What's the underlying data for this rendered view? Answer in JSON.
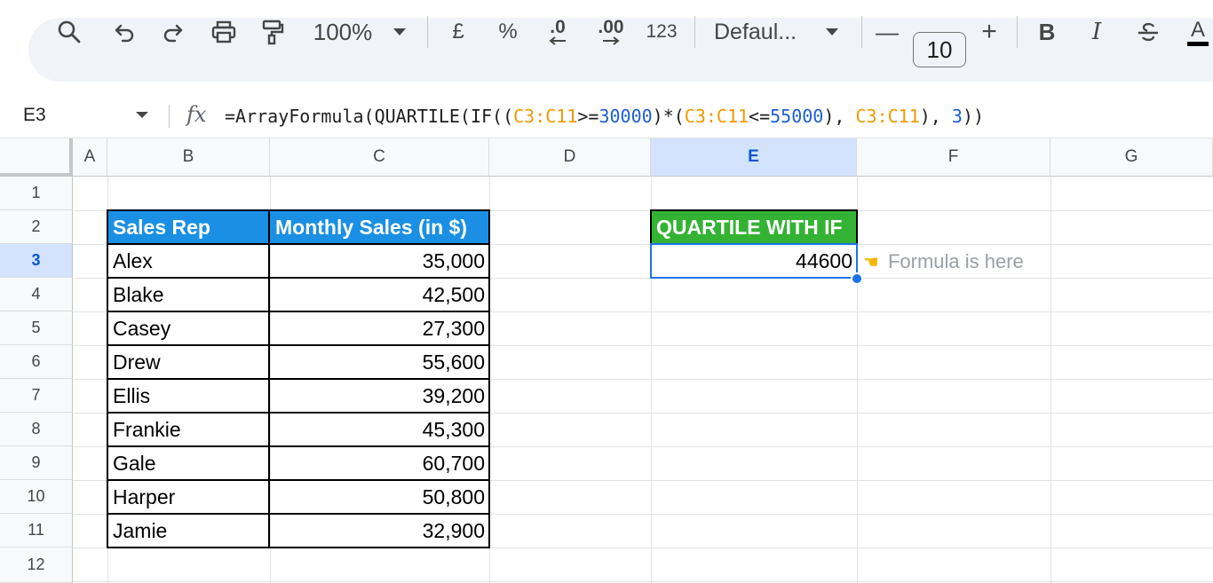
{
  "toolbar": {
    "zoom": "100%",
    "currency": "£",
    "percent": "%",
    "decrease_decimals": ".0",
    "increase_decimals": ".00",
    "number_format": "123",
    "font_name": "Defaul...",
    "font_size": "10",
    "minus": "—",
    "plus": "+",
    "bold": "B",
    "italic": "I",
    "text_color": "A"
  },
  "formula_bar": {
    "name_box": "E3",
    "fx_label": "fx",
    "formula_parts": {
      "p1": "=ArrayFormula(QUARTILE(IF((",
      "r1": "C3:C11",
      "p2": ">=",
      "n1": "30000",
      "p3": ")*(",
      "r2": "C3:C11",
      "p4": "<=",
      "n2": "55000",
      "p5": "), ",
      "r3": "C3:C11",
      "p6": "), ",
      "n3": "3",
      "p7": "))"
    }
  },
  "grid": {
    "columns": [
      "A",
      "B",
      "C",
      "D",
      "E",
      "F",
      "G"
    ],
    "rows": [
      "1",
      "2",
      "3",
      "4",
      "5",
      "6",
      "7",
      "8",
      "9",
      "10",
      "11",
      "12"
    ],
    "selected_column": "E",
    "selected_row": "3"
  },
  "table": {
    "headers": [
      "Sales Rep",
      "Monthly Sales (in $)"
    ],
    "rows": [
      [
        "Alex",
        "35,000"
      ],
      [
        "Blake",
        "42,500"
      ],
      [
        "Casey",
        "27,300"
      ],
      [
        "Drew",
        "55,600"
      ],
      [
        "Ellis",
        "39,200"
      ],
      [
        "Frankie",
        "45,300"
      ],
      [
        "Gale",
        "60,700"
      ],
      [
        "Harper",
        "50,800"
      ],
      [
        "Jamie",
        "32,900"
      ]
    ]
  },
  "quartile": {
    "header": "QUARTILE WITH IF",
    "value": "44600",
    "note": "Formula is here"
  },
  "colors": {
    "table_header": "#1a8fe3",
    "quartile_header": "#34b233",
    "selection": "#1a73e8"
  }
}
